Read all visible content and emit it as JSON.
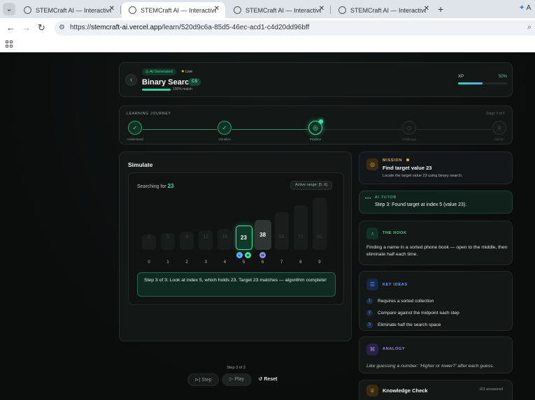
{
  "browser": {
    "tabs": [
      {
        "title": "STEMCraft AI — Interactive STEM",
        "active": false
      },
      {
        "title": "STEMCraft AI — Interactive STEM",
        "active": true
      },
      {
        "title": "STEMCraft AI — Interactive STEM",
        "active": false
      },
      {
        "title": "STEMCraft AI — Interactive STEM",
        "active": false
      }
    ],
    "url_scheme": "https://",
    "url_domain": "stemcraft-ai.vercel.app",
    "url_path": "/learn/520d9c6a-85d5-46ec-acd1-c4d20dd96bff",
    "ext_label": "A"
  },
  "header": {
    "ai_badge": "AI Generated",
    "live_badge": "Live",
    "title": "Binary Search",
    "subject_badge": "CS",
    "match_text": "100% match",
    "match_fraction": 1.0,
    "xp_label": "XP",
    "xp_value": "50%",
    "xp_fraction": 0.5
  },
  "journey": {
    "label": "LEARNING JOURNEY",
    "stage_text": "Stage 3 of 5",
    "steps": [
      {
        "name": "Understand",
        "state": "done",
        "icon": "✓"
      },
      {
        "name": "Visualize",
        "state": "done",
        "icon": "✓"
      },
      {
        "name": "Practice",
        "state": "current",
        "icon": "◎"
      },
      {
        "name": "Challenge",
        "state": "todo",
        "icon": "◇"
      },
      {
        "name": "Master",
        "state": "todo",
        "icon": "♕"
      }
    ]
  },
  "simulation": {
    "title": "Simulate",
    "searching_label": "Searching for",
    "target": "23",
    "active_range": "Active range: [5, 6]",
    "array": [
      {
        "value": "2",
        "index": "0",
        "state": "dim"
      },
      {
        "value": "5",
        "index": "1",
        "state": "dim"
      },
      {
        "value": "8",
        "index": "2",
        "state": "dim"
      },
      {
        "value": "12",
        "index": "3",
        "state": "dim"
      },
      {
        "value": "16",
        "index": "4",
        "state": "dim"
      },
      {
        "value": "23",
        "index": "5",
        "state": "found",
        "pointers": [
          "L",
          "M"
        ]
      },
      {
        "value": "38",
        "index": "6",
        "state": "mid",
        "pointers": [
          "H"
        ]
      },
      {
        "value": "56",
        "index": "7",
        "state": "dim"
      },
      {
        "value": "72",
        "index": "8",
        "state": "dim"
      },
      {
        "value": "91",
        "index": "9",
        "state": "dim"
      }
    ],
    "message": "Step 3 of 3: Look at index 5, which holds 23. Target 23 matches — algorithm complete!",
    "step_counter": "Step 3 of 3",
    "buttons": {
      "step": "Step",
      "play": "Play",
      "reset": "Reset"
    }
  },
  "mission": {
    "tag": "MISSION",
    "title": "Find target value 23",
    "subtitle": "Locate the target value 23 using binary search."
  },
  "tutor": {
    "tag": "AI TUTOR",
    "text": "Step 3: Found target at index 5 (value 23)."
  },
  "hook": {
    "tag": "THE HOOK",
    "text": "Finding a name in a sorted phone book — open to the middle, then eliminate half each time."
  },
  "ideas": {
    "tag": "KEY IDEAS",
    "items": [
      {
        "num": "1",
        "text": "Requires a sorted collection"
      },
      {
        "num": "2",
        "text": "Compare against the midpoint each step"
      },
      {
        "num": "3",
        "text": "Eliminate half the search space"
      }
    ]
  },
  "analogy": {
    "tag": "ANALOGY",
    "text": "Like guessing a number: 'Higher or lower?' after each guess."
  },
  "quiz": {
    "title": "Knowledge Check",
    "count": "0/3 answered"
  },
  "colors": {
    "accent": "#3fe0a3",
    "background": "#0b0d0d",
    "mission": "#e6a93a",
    "ideas": "#64a3ff",
    "analogy": "#a58bf0"
  }
}
